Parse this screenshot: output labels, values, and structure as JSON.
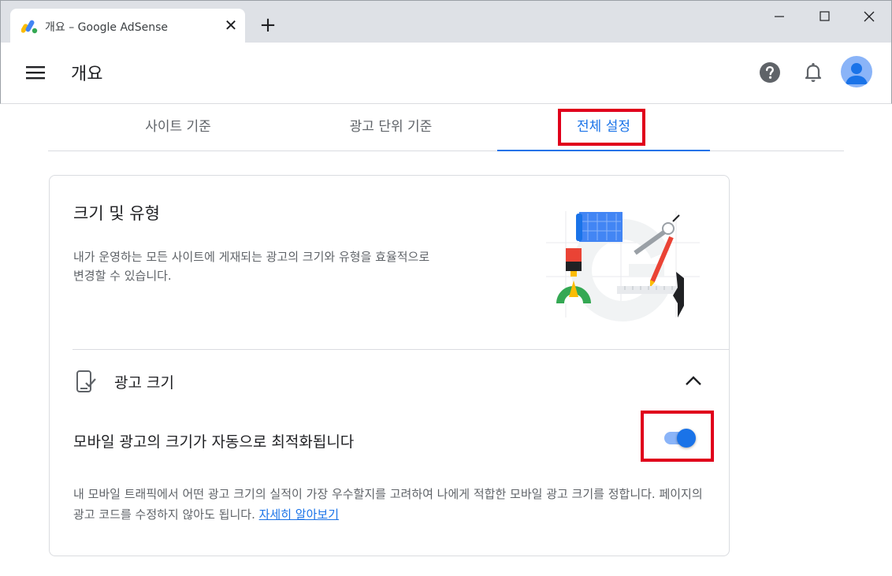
{
  "browser": {
    "tab_title": "개요 – Google AdSense",
    "favicon": "adsense-logo",
    "close_tab": "✕",
    "new_tab": "+"
  },
  "header": {
    "title": "개요",
    "icons": [
      "menu-icon",
      "help-icon",
      "notifications-icon",
      "account-avatar"
    ]
  },
  "tabs": [
    {
      "label": "사이트 기준",
      "selected": false
    },
    {
      "label": "광고 단위 기준",
      "selected": false
    },
    {
      "label": "전체 설정",
      "selected": true
    }
  ],
  "card": {
    "title": "크기 및 유형",
    "description": "내가 운영하는 모든 사이트에 게재되는 광고의 크기와 유형을 효율적으로 변경할 수 있습니다.",
    "section": {
      "title": "광고 크기",
      "expanded": true,
      "setting_label": "모바일 광고의 크기가 자동으로 최적화됩니다",
      "toggle_on": true,
      "setting_description": "내 모바일 트래픽에서 어떤 광고 크기의 실적이 가장 우수할지를 고려하여 나에게 적합한 모바일 광고 크기를 정합니다. 페이지의 광고 코드를 수정하지 않아도 됩니다. ",
      "learn_more": "자세히 알아보기"
    }
  },
  "colors": {
    "accent": "#1a73e8",
    "toggle_track": "#8ab4f8",
    "highlight": "#e0001b",
    "text_secondary": "#5f6368"
  }
}
